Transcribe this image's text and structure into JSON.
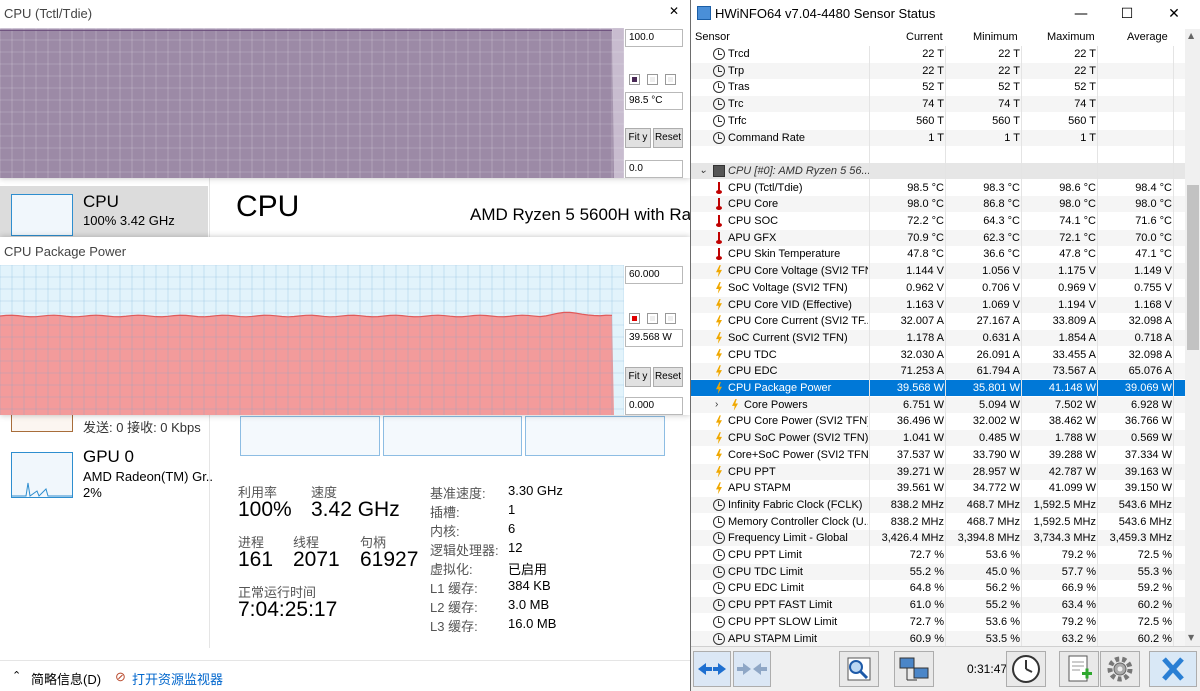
{
  "taskmgr": {
    "cpu_card": {
      "title": "CPU",
      "sub": "100%  3.42 GHz"
    },
    "main_title": "CPU",
    "model": "AMD Ryzen 5 5600H with Ra",
    "gpu_card": {
      "title": "GPU 0",
      "line1": "AMD Radeon(TM) Gr..",
      "line2": "2%"
    },
    "net_line": "发送: 0 接收: 0 Kbps",
    "stats": {
      "util_label": "利用率",
      "util_value": "100%",
      "speed_label": "速度",
      "speed_value": "3.42 GHz",
      "proc_label": "进程",
      "proc_value": "161",
      "thread_label": "线程",
      "thread_value": "2071",
      "handle_label": "句柄",
      "handle_value": "61927",
      "uptime_label": "正常运行时间",
      "uptime_value": "7:04:25:17"
    },
    "specs": [
      {
        "label": "基准速度:",
        "value": "3.30 GHz"
      },
      {
        "label": "插槽:",
        "value": "1"
      },
      {
        "label": "内核:",
        "value": "6"
      },
      {
        "label": "逻辑处理器:",
        "value": "12"
      },
      {
        "label": "虚拟化:",
        "value": "已启用"
      },
      {
        "label": "L1 缓存:",
        "value": "384 KB"
      },
      {
        "label": "L2 缓存:",
        "value": "3.0 MB"
      },
      {
        "label": "L3 缓存:",
        "value": "16.0 MB"
      }
    ],
    "footer": {
      "brief": "简略信息(D)",
      "monitor": "打开资源监视器"
    }
  },
  "graph_temp": {
    "title": "CPU (Tctl/Tdie)",
    "max": "100.0",
    "current": "98.5 °C",
    "min": "0.0",
    "fit_label": "Fit y",
    "reset_label": "Reset",
    "fill_color": "#9c8aa6",
    "level": 0.985
  },
  "graph_power": {
    "title": "CPU Package Power",
    "max": "60.000",
    "current": "39.568 W",
    "min": "0.000",
    "fit_label": "Fit y",
    "reset_label": "Reset",
    "fill_color": "#f39b9b",
    "level": 0.66
  },
  "hw": {
    "title": "HWiNFO64 v7.04-4480 Sensor Status",
    "ctrl_min": "—",
    "ctrl_max": "☐",
    "ctrl_close": "✕",
    "columns": {
      "sensor": "Sensor",
      "current": "Current",
      "minimum": "Minimum",
      "maximum": "Maximum",
      "average": "Average"
    },
    "time": "0:31:47",
    "rows": [
      {
        "icon": "clock",
        "name": "Trcd",
        "cur": "22 T",
        "min": "22 T",
        "max": "22 T",
        "avg": ""
      },
      {
        "icon": "clock",
        "name": "Trp",
        "cur": "22 T",
        "min": "22 T",
        "max": "22 T",
        "avg": ""
      },
      {
        "icon": "clock",
        "name": "Tras",
        "cur": "52 T",
        "min": "52 T",
        "max": "52 T",
        "avg": ""
      },
      {
        "icon": "clock",
        "name": "Trc",
        "cur": "74 T",
        "min": "74 T",
        "max": "74 T",
        "avg": ""
      },
      {
        "icon": "clock",
        "name": "Trfc",
        "cur": "560 T",
        "min": "560 T",
        "max": "560 T",
        "avg": ""
      },
      {
        "icon": "clock",
        "name": "Command Rate",
        "cur": "1 T",
        "min": "1 T",
        "max": "1 T",
        "avg": ""
      },
      {
        "icon": "none",
        "name": "",
        "cur": "",
        "min": "",
        "max": "",
        "avg": ""
      },
      {
        "icon": "chip",
        "name": "CPU [#0]: AMD Ryzen 5 56...",
        "cur": "",
        "min": "",
        "max": "",
        "avg": "",
        "group": true
      },
      {
        "icon": "therm",
        "name": "CPU (Tctl/Tdie)",
        "cur": "98.5 °C",
        "min": "98.3 °C",
        "max": "98.6 °C",
        "avg": "98.4 °C"
      },
      {
        "icon": "therm",
        "name": "CPU Core",
        "cur": "98.0 °C",
        "min": "86.8 °C",
        "max": "98.0 °C",
        "avg": "98.0 °C"
      },
      {
        "icon": "therm",
        "name": "CPU SOC",
        "cur": "72.2 °C",
        "min": "64.3 °C",
        "max": "74.1 °C",
        "avg": "71.6 °C"
      },
      {
        "icon": "therm",
        "name": "APU GFX",
        "cur": "70.9 °C",
        "min": "62.3 °C",
        "max": "72.1 °C",
        "avg": "70.0 °C"
      },
      {
        "icon": "therm",
        "name": "CPU Skin Temperature",
        "cur": "47.8 °C",
        "min": "36.6 °C",
        "max": "47.8 °C",
        "avg": "47.1 °C"
      },
      {
        "icon": "bolt",
        "name": "CPU Core Voltage (SVI2 TFN)",
        "cur": "1.144 V",
        "min": "1.056 V",
        "max": "1.175 V",
        "avg": "1.149 V"
      },
      {
        "icon": "bolt",
        "name": "SoC Voltage (SVI2 TFN)",
        "cur": "0.962 V",
        "min": "0.706 V",
        "max": "0.969 V",
        "avg": "0.755 V"
      },
      {
        "icon": "bolt",
        "name": "CPU Core VID (Effective)",
        "cur": "1.163 V",
        "min": "1.069 V",
        "max": "1.194 V",
        "avg": "1.168 V"
      },
      {
        "icon": "bolt",
        "name": "CPU Core Current (SVI2 TF...",
        "cur": "32.007 A",
        "min": "27.167 A",
        "max": "33.809 A",
        "avg": "32.098 A"
      },
      {
        "icon": "bolt",
        "name": "SoC Current (SVI2 TFN)",
        "cur": "1.178 A",
        "min": "0.631 A",
        "max": "1.854 A",
        "avg": "0.718 A"
      },
      {
        "icon": "bolt",
        "name": "CPU TDC",
        "cur": "32.030 A",
        "min": "26.091 A",
        "max": "33.455 A",
        "avg": "32.098 A"
      },
      {
        "icon": "bolt",
        "name": "CPU EDC",
        "cur": "71.253 A",
        "min": "61.794 A",
        "max": "73.567 A",
        "avg": "65.076 A"
      },
      {
        "icon": "bolt",
        "name": "CPU Package Power",
        "cur": "39.568 W",
        "min": "35.801 W",
        "max": "41.148 W",
        "avg": "39.069 W",
        "selected": true
      },
      {
        "icon": "bolt",
        "name": "Core Powers",
        "cur": "6.751 W",
        "min": "5.094 W",
        "max": "7.502 W",
        "avg": "6.928 W",
        "expandable": true
      },
      {
        "icon": "bolt",
        "name": "CPU Core Power (SVI2 TFN)",
        "cur": "36.496 W",
        "min": "32.002 W",
        "max": "38.462 W",
        "avg": "36.766 W"
      },
      {
        "icon": "bolt",
        "name": "CPU SoC Power (SVI2 TFN)",
        "cur": "1.041 W",
        "min": "0.485 W",
        "max": "1.788 W",
        "avg": "0.569 W"
      },
      {
        "icon": "bolt",
        "name": "Core+SoC Power (SVI2 TFN)",
        "cur": "37.537 W",
        "min": "33.790 W",
        "max": "39.288 W",
        "avg": "37.334 W"
      },
      {
        "icon": "bolt",
        "name": "CPU PPT",
        "cur": "39.271 W",
        "min": "28.957 W",
        "max": "42.787 W",
        "avg": "39.163 W"
      },
      {
        "icon": "bolt",
        "name": "APU STAPM",
        "cur": "39.561 W",
        "min": "34.772 W",
        "max": "41.099 W",
        "avg": "39.150 W"
      },
      {
        "icon": "clock",
        "name": "Infinity Fabric Clock (FCLK)",
        "cur": "838.2 MHz",
        "min": "468.7 MHz",
        "max": "1,592.5 MHz",
        "avg": "543.6 MHz"
      },
      {
        "icon": "clock",
        "name": "Memory Controller Clock (U...",
        "cur": "838.2 MHz",
        "min": "468.7 MHz",
        "max": "1,592.5 MHz",
        "avg": "543.6 MHz"
      },
      {
        "icon": "clock",
        "name": "Frequency Limit - Global",
        "cur": "3,426.4 MHz",
        "min": "3,394.8 MHz",
        "max": "3,734.3 MHz",
        "avg": "3,459.3 MHz"
      },
      {
        "icon": "clock",
        "name": "CPU PPT Limit",
        "cur": "72.7 %",
        "min": "53.6 %",
        "max": "79.2 %",
        "avg": "72.5 %"
      },
      {
        "icon": "clock",
        "name": "CPU TDC Limit",
        "cur": "55.2 %",
        "min": "45.0 %",
        "max": "57.7 %",
        "avg": "55.3 %"
      },
      {
        "icon": "clock",
        "name": "CPU EDC Limit",
        "cur": "64.8 %",
        "min": "56.2 %",
        "max": "66.9 %",
        "avg": "59.2 %"
      },
      {
        "icon": "clock",
        "name": "CPU PPT FAST Limit",
        "cur": "61.0 %",
        "min": "55.2 %",
        "max": "63.4 %",
        "avg": "60.2 %"
      },
      {
        "icon": "clock",
        "name": "CPU PPT SLOW Limit",
        "cur": "72.7 %",
        "min": "53.6 %",
        "max": "79.2 %",
        "avg": "72.5 %"
      },
      {
        "icon": "clock",
        "name": "APU STAPM Limit",
        "cur": "60.9 %",
        "min": "53.5 %",
        "max": "63.2 %",
        "avg": "60.2 %"
      }
    ]
  }
}
